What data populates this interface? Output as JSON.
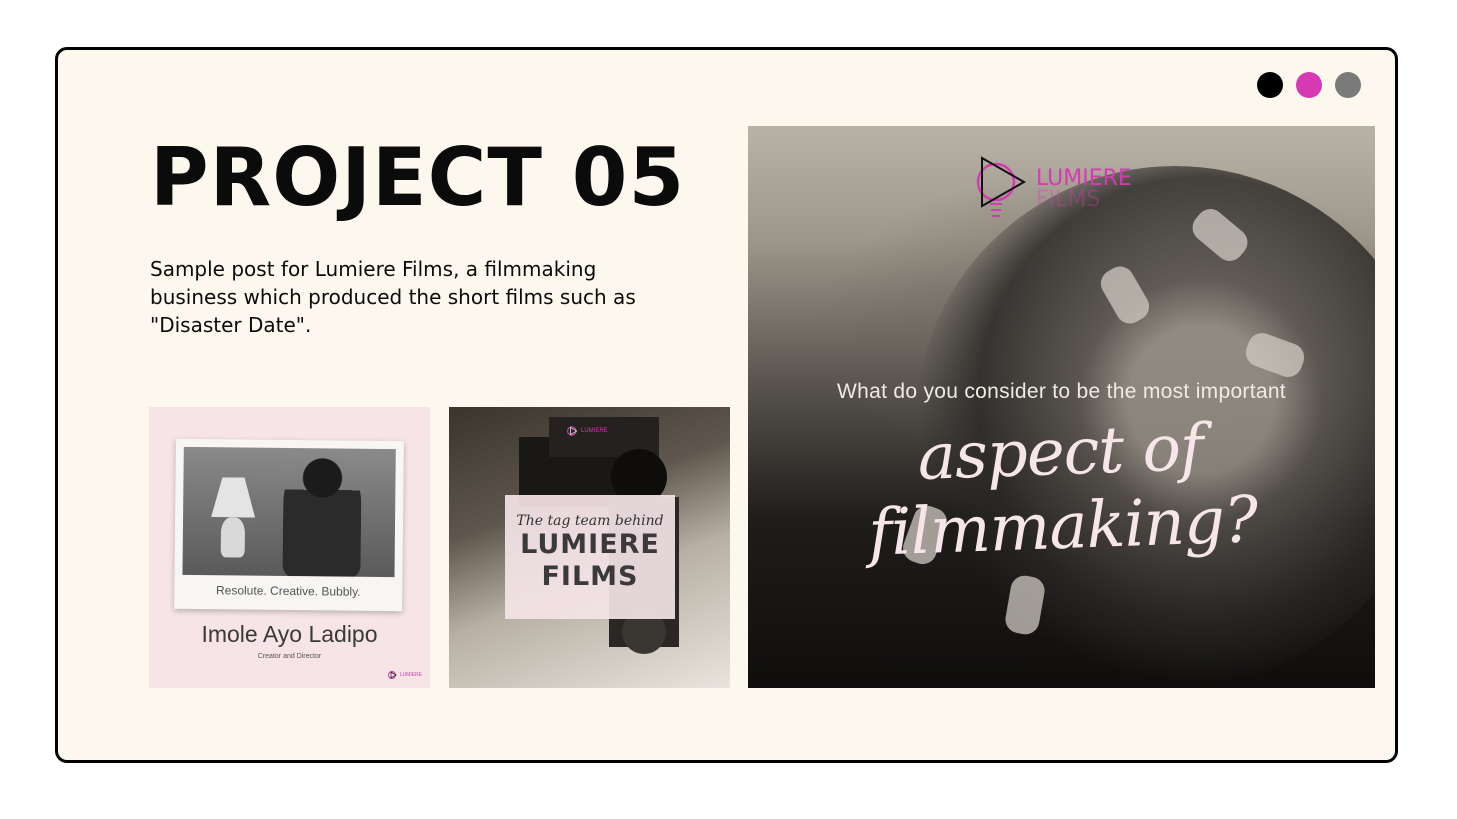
{
  "colors": {
    "dot1": "#000000",
    "dot2": "#d63ab3",
    "dot3": "#7a7a7a",
    "accent": "#d63ab3"
  },
  "title": "PROJECT 05",
  "description": "Sample post for Lumiere Films, a filmmaking business which produced the short films such as \"Disaster Date\".",
  "thumb1": {
    "caption": "Resolute. Creative. Bubbly.",
    "name": "Imole Ayo Ladipo",
    "role": "Creator and Director",
    "logo": "LUMIERE"
  },
  "thumb2": {
    "logo": "LUMIERE",
    "script": "The tag team behind",
    "line1": "LUMIERE",
    "line2": "FILMS"
  },
  "hero": {
    "logo_line1": "LUMIERE",
    "logo_line2": "FILMS",
    "question": "What do you consider to be the most important",
    "script": "aspect of filmmaking?"
  }
}
